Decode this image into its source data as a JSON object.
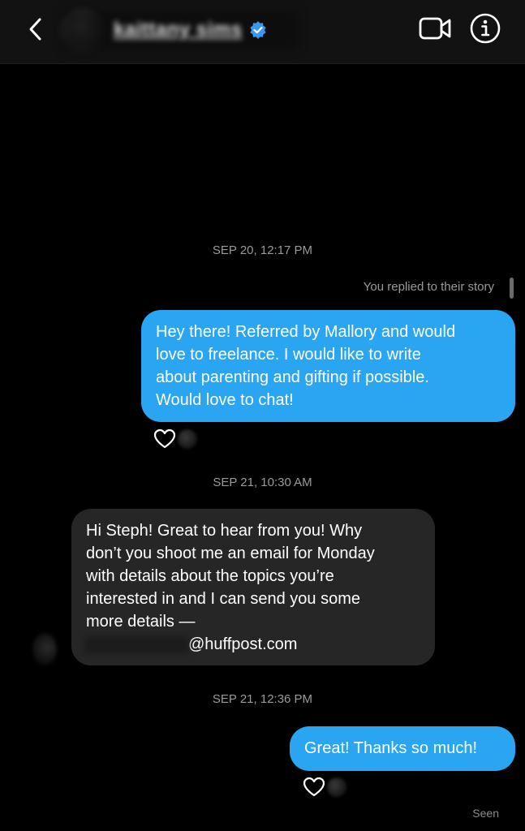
{
  "header": {
    "back_icon": "chevron-left-icon",
    "contact_name": "kaittany sims",
    "verified_icon": "verified-badge-icon",
    "video_icon": "video-camera-icon",
    "info_icon": "info-icon",
    "colors": {
      "background": "#121212",
      "verified": "#3897f0"
    }
  },
  "thread": {
    "timestamps": [
      "SEP 20, 12:17 PM",
      "SEP 21, 10:30 AM",
      "SEP 21, 12:36 PM"
    ],
    "story_reply_note": "You replied to their story",
    "messages": [
      {
        "direction": "sent",
        "lines": [
          "Hey there! Referred by Mallory and would",
          "love to freelance. I would like to write",
          "about parenting and gifting if possible.",
          "Would love to chat!"
        ],
        "reaction_icon": "heart-outline-icon"
      },
      {
        "direction": "received",
        "lines": [
          "Hi Steph! Great to hear from you! Why",
          "don’t you shoot me an email for Monday",
          "with details about the topics you’re",
          "interested in and I can send you some",
          "more details —"
        ],
        "email_domain": "@huffpost.com"
      },
      {
        "direction": "sent",
        "lines": [
          "Great! Thanks so much!"
        ],
        "reaction_icon": "heart-outline-icon"
      }
    ],
    "seen_label": "Seen"
  },
  "colors": {
    "sent_bubble": "#2aa5f2",
    "received_bubble": "#262626",
    "page_background": "#000000",
    "meta_text": "#9a9a9a"
  }
}
